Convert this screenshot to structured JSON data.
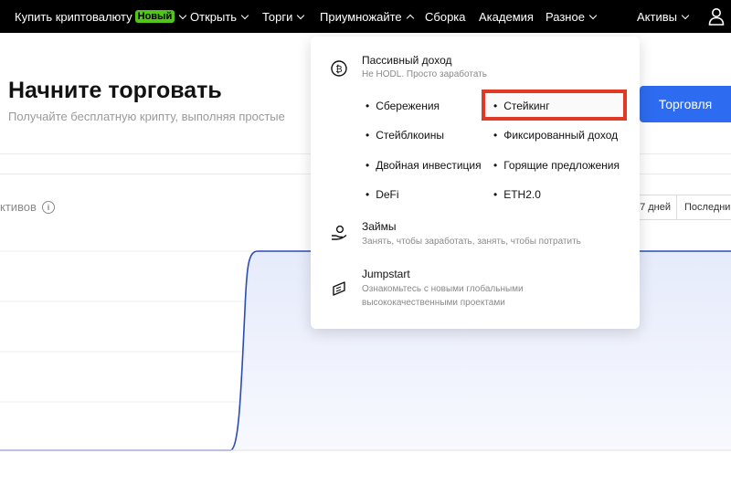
{
  "nav": {
    "buy_crypto": "Купить криптовалюту",
    "new_badge": "Новый",
    "open": "Открыть",
    "trading": "Торги",
    "multiply": "Приумножайте",
    "build": "Сборка",
    "academy": "Академия",
    "misc": "Разное",
    "assets": "Активы"
  },
  "hero": {
    "title": "Начните торговать",
    "subtitle": "Получайте бесплатную крипту, выполняя простые",
    "trade_button": "Торговля"
  },
  "assets_section": {
    "label": "ктивов",
    "seg_7days": "7 дней",
    "seg_last": "Последние"
  },
  "dropdown": {
    "passive": {
      "title": "Пассивный доход",
      "desc": "Не HODL. Просто заработать",
      "links": [
        "Сбережения",
        "Стейкинг",
        "Стейблкоины",
        "Фиксированный доход",
        "Двойная инвестиция",
        "Горящие предложения",
        "DeFi",
        "ETH2.0"
      ]
    },
    "loans": {
      "title": "Займы",
      "desc": "Занять, чтобы заработать, занять, чтобы потратить"
    },
    "jumpstart": {
      "title": "Jumpstart",
      "desc_line1": "Ознакомьтесь с новыми глобальными",
      "desc_line2": "высококачественными проектами"
    }
  },
  "colors": {
    "accent": "#2d6bf0",
    "badge": "#52c41a",
    "highlight": "#e03a26",
    "chart_line": "#2b4bb5"
  }
}
